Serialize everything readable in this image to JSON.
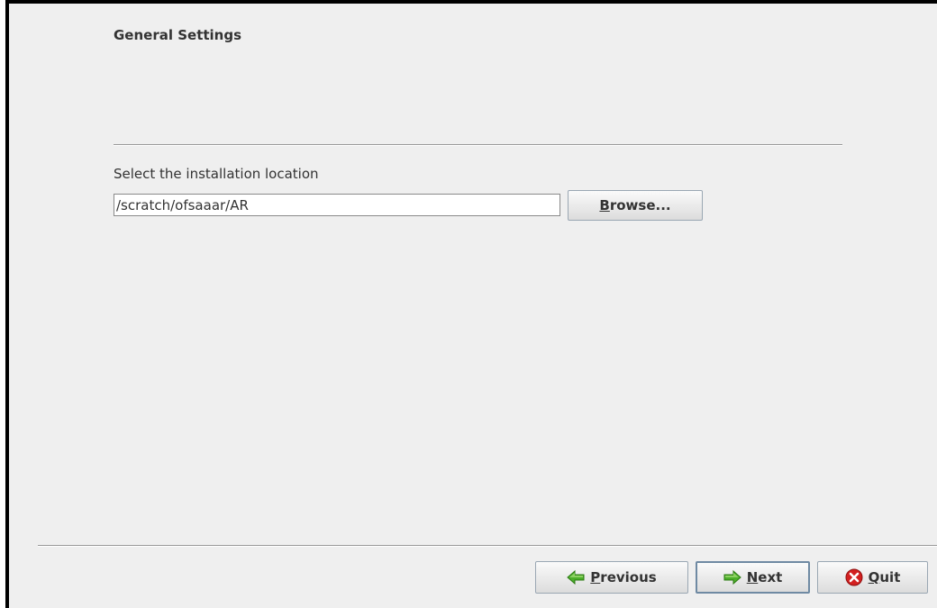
{
  "page": {
    "title": "General Settings"
  },
  "install": {
    "label": "Select the installation location",
    "path_value": "/scratch/ofsaaar/AR",
    "browse": {
      "mnemonic": "B",
      "rest": "rowse..."
    }
  },
  "nav": {
    "previous": {
      "mnemonic": "P",
      "rest": "revious"
    },
    "next": {
      "mnemonic": "N",
      "rest": "ext"
    },
    "quit": {
      "mnemonic": "Q",
      "rest": "uit"
    }
  },
  "icons": {
    "previous": "green-left-arrow-icon",
    "next": "green-right-arrow-icon",
    "quit": "red-x-circle-icon"
  },
  "colors": {
    "panel_bg": "#efefef",
    "arrow_green": "#4caf2a",
    "quit_red": "#d32020"
  }
}
